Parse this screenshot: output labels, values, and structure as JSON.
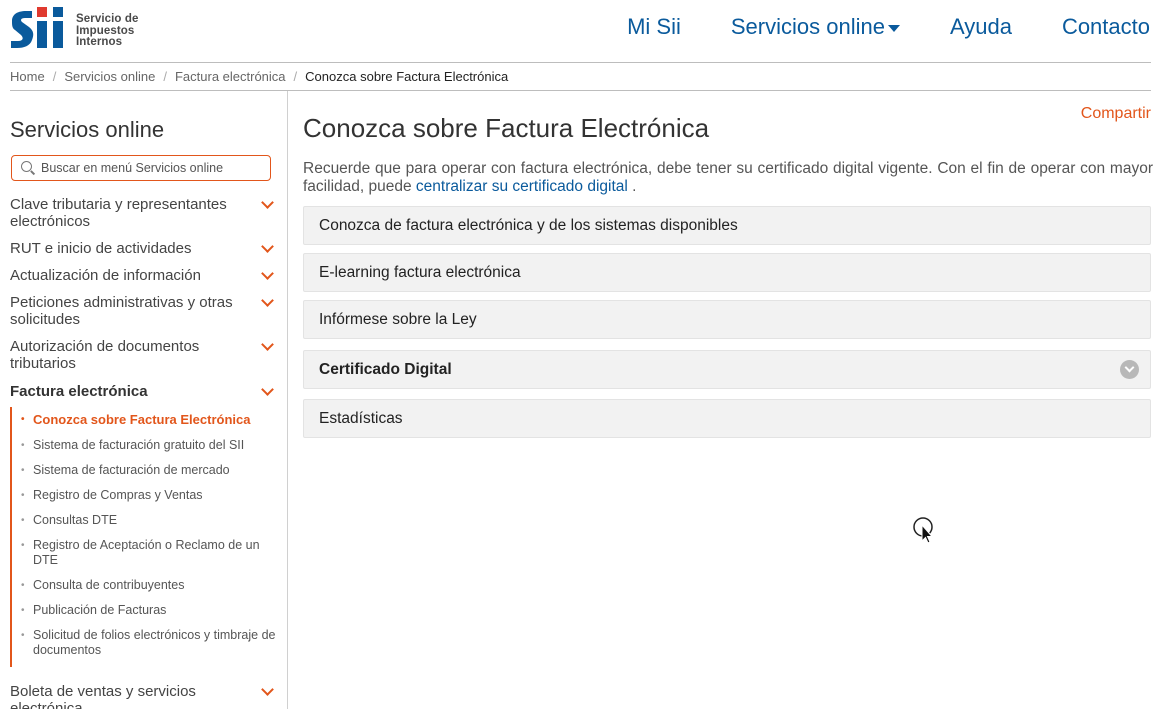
{
  "header": {
    "logo_text": [
      "Servicio de",
      "Impuestos",
      "Internos"
    ],
    "nav": [
      {
        "label": "Mi Sii"
      },
      {
        "label": "Servicios online",
        "has_dropdown": true
      },
      {
        "label": "Ayuda"
      },
      {
        "label": "Contacto"
      }
    ]
  },
  "breadcrumb": {
    "items": [
      "Home",
      "Servicios online",
      "Factura electrónica"
    ],
    "separator": "/",
    "current": "Conozca sobre Factura Electrónica"
  },
  "sidebar": {
    "title": "Servicios online",
    "search_placeholder": "Buscar en menú Servicios online",
    "items": [
      {
        "label": "Clave tributaria y representantes electrónicos"
      },
      {
        "label": "RUT e inicio de actividades"
      },
      {
        "label": "Actualización de información"
      },
      {
        "label": "Peticiones administrativas y otras solicitudes"
      },
      {
        "label": "Autorización de documentos tributarios"
      },
      {
        "label": "Factura electrónica",
        "expanded": true
      },
      {
        "label": "Boleta de ventas y servicios electrónica"
      }
    ],
    "subitems": [
      {
        "label": "Conozca sobre Factura Electrónica",
        "active": true
      },
      {
        "label": "Sistema de facturación gratuito del SII"
      },
      {
        "label": "Sistema de facturación de mercado"
      },
      {
        "label": "Registro de Compras y Ventas"
      },
      {
        "label": "Consultas DTE"
      },
      {
        "label": "Registro de Aceptación o Reclamo de un DTE"
      },
      {
        "label": "Consulta de contribuyentes"
      },
      {
        "label": "Publicación de Facturas"
      },
      {
        "label": "Solicitud de folios electrónicos y timbraje de documentos"
      }
    ]
  },
  "main": {
    "share_label": "Compartir",
    "title": "Conozca sobre Factura Electrónica",
    "intro_text": "Recuerde que para operar con factura electrónica, debe tener su certificado digital vigente. Con el fin de operar con mayor facilidad, puede ",
    "intro_link": "centralizar su certificado digital",
    "intro_end": " .",
    "accordions": [
      {
        "label": "Conozca de factura electrónica y de los sistemas disponibles"
      },
      {
        "label": "E-learning factura electrónica"
      },
      {
        "label": "Infórmese sobre la Ley"
      },
      {
        "label": "Certificado Digital",
        "bold": true,
        "icon": "chevron-circle-down-icon"
      },
      {
        "label": "Estadísticas"
      }
    ]
  },
  "colors": {
    "brand_blue": "#0a5a9c",
    "accent_orange": "#e2561b",
    "accordion_bg": "#f2f2f2"
  }
}
